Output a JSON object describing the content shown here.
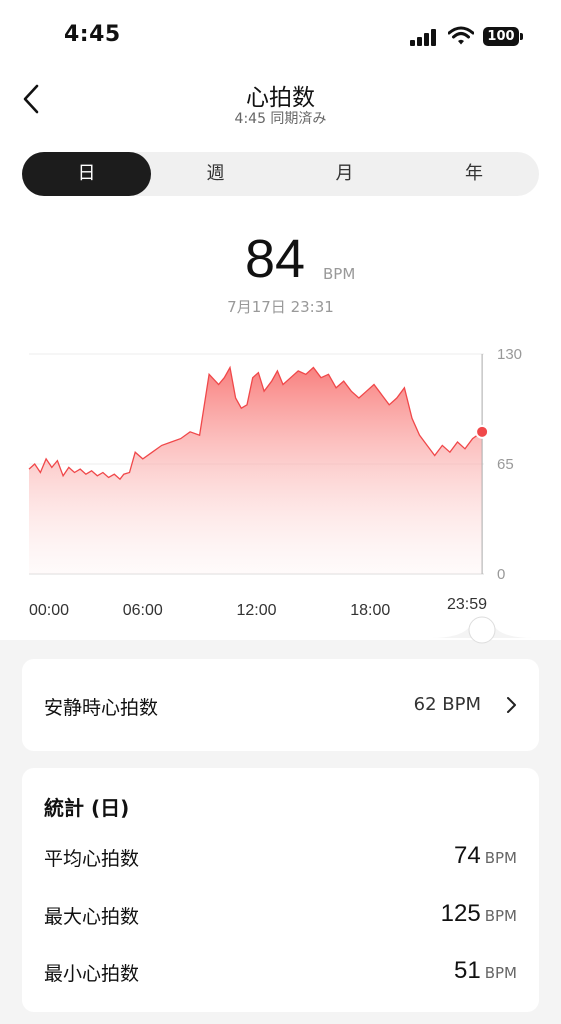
{
  "status_bar": {
    "time": "4:45",
    "battery": "100"
  },
  "header": {
    "title": "心拍数",
    "subtitle": "4:45 同期済み"
  },
  "tabs": [
    {
      "label": "日",
      "active": true
    },
    {
      "label": "週",
      "active": false
    },
    {
      "label": "月",
      "active": false
    },
    {
      "label": "年",
      "active": false
    }
  ],
  "current": {
    "value": "84",
    "unit": "BPM",
    "datetime": "7月17日 23:31"
  },
  "chart_data": {
    "type": "area",
    "x_tick_labels": [
      "00:00",
      "06:00",
      "12:00",
      "18:00",
      "23:59"
    ],
    "y_tick_labels": [
      "130",
      "65",
      "0"
    ],
    "ylim": [
      0,
      130
    ],
    "xlim": [
      0,
      24
    ],
    "marker_time": "23:59",
    "series": [
      {
        "x": [
          0,
          0.3,
          0.6,
          0.9,
          1.2,
          1.5,
          1.8,
          2.1,
          2.4,
          2.7,
          3.0,
          3.3,
          3.6,
          3.9,
          4.2,
          4.5,
          4.8,
          5.0,
          5.3,
          5.6,
          6.0,
          6.5,
          7.0,
          7.5,
          8.0,
          8.5,
          9.0,
          9.5,
          10.0,
          10.3,
          10.6,
          10.9,
          11.2,
          11.5,
          11.8,
          12.1,
          12.4,
          12.8,
          13.1,
          13.4,
          13.8,
          14.2,
          14.6,
          15.0,
          15.4,
          15.8,
          16.2,
          16.6,
          17.0,
          17.4,
          17.8,
          18.2,
          18.6,
          19.0,
          19.4,
          19.8,
          20.2,
          20.6,
          21.0,
          21.4,
          21.8,
          22.2,
          22.6,
          23.0,
          23.4,
          23.9
        ],
        "values": [
          62,
          65,
          60,
          68,
          63,
          67,
          58,
          63,
          60,
          62,
          59,
          61,
          58,
          60,
          57,
          59,
          56,
          59,
          60,
          72,
          68,
          72,
          76,
          78,
          80,
          84,
          82,
          118,
          112,
          116,
          122,
          104,
          98,
          100,
          116,
          119,
          108,
          114,
          120,
          112,
          116,
          120,
          118,
          122,
          116,
          118,
          110,
          114,
          108,
          104,
          108,
          112,
          106,
          100,
          104,
          110,
          92,
          82,
          76,
          70,
          76,
          72,
          78,
          74,
          80,
          84
        ]
      }
    ]
  },
  "resting_hr": {
    "label": "安静時心拍数",
    "value": "62 BPM"
  },
  "stats": {
    "title": "統計 (日)",
    "rows": [
      {
        "label": "平均心拍数",
        "value": "74",
        "unit": "BPM"
      },
      {
        "label": "最大心拍数",
        "value": "125",
        "unit": "BPM"
      },
      {
        "label": "最小心拍数",
        "value": "51",
        "unit": "BPM"
      }
    ]
  },
  "colors": {
    "accent": "#f0484a",
    "fill_top": "#f87a78"
  }
}
